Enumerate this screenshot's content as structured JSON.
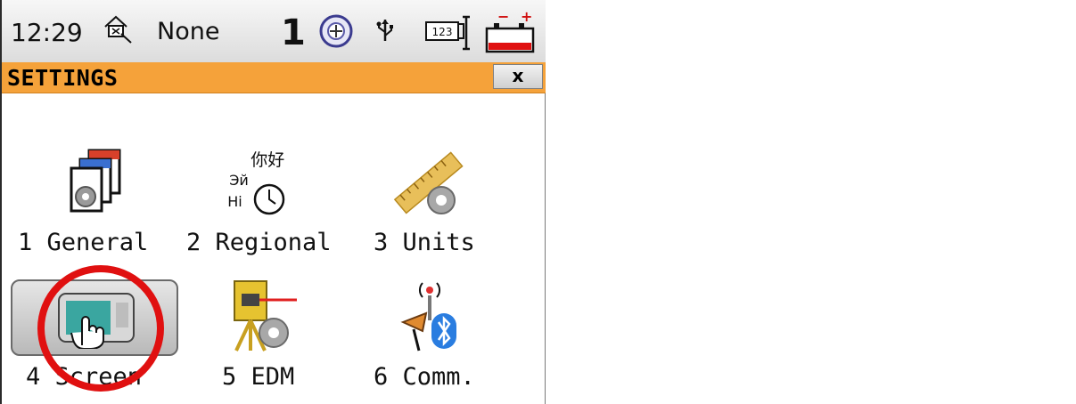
{
  "status_bar": {
    "time": "12:29",
    "prism": "None",
    "face_indicator": "1",
    "icons": [
      "home-target-icon",
      "target-icon",
      "usb-icon",
      "keyboard-123-icon",
      "battery-icon"
    ]
  },
  "window": {
    "title": "SETTINGS",
    "close_label": "x"
  },
  "menu_items": [
    {
      "label": "1 General",
      "icon": "documents-gear-icon"
    },
    {
      "label": "2 Regional",
      "icon": "language-clock-icon",
      "icon_text": {
        "chinese": "你好",
        "russian": "Эй",
        "english": "Hi"
      }
    },
    {
      "label": "3 Units",
      "icon": "ruler-gear-icon"
    },
    {
      "label": "4 Screen",
      "icon": "screen-touch-icon",
      "selected": true
    },
    {
      "label": "5 EDM",
      "icon": "total-station-gear-icon"
    },
    {
      "label": "6 Comm.",
      "icon": "antenna-bluetooth-icon"
    }
  ],
  "colors": {
    "title_bar": "#f5a23a",
    "annotation": "#e01010"
  }
}
